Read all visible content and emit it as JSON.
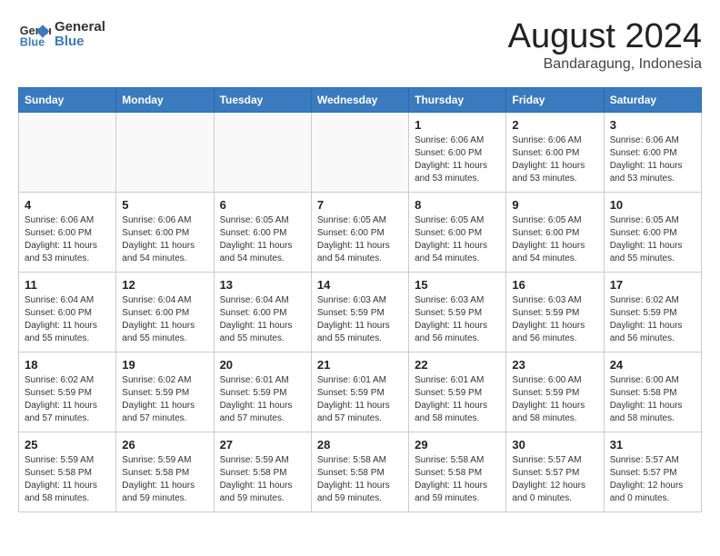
{
  "header": {
    "logo_line1": "General",
    "logo_line2": "Blue",
    "month": "August 2024",
    "location": "Bandaragung, Indonesia"
  },
  "weekdays": [
    "Sunday",
    "Monday",
    "Tuesday",
    "Wednesday",
    "Thursday",
    "Friday",
    "Saturday"
  ],
  "weeks": [
    [
      {
        "day": "",
        "info": ""
      },
      {
        "day": "",
        "info": ""
      },
      {
        "day": "",
        "info": ""
      },
      {
        "day": "",
        "info": ""
      },
      {
        "day": "1",
        "info": "Sunrise: 6:06 AM\nSunset: 6:00 PM\nDaylight: 11 hours\nand 53 minutes."
      },
      {
        "day": "2",
        "info": "Sunrise: 6:06 AM\nSunset: 6:00 PM\nDaylight: 11 hours\nand 53 minutes."
      },
      {
        "day": "3",
        "info": "Sunrise: 6:06 AM\nSunset: 6:00 PM\nDaylight: 11 hours\nand 53 minutes."
      }
    ],
    [
      {
        "day": "4",
        "info": "Sunrise: 6:06 AM\nSunset: 6:00 PM\nDaylight: 11 hours\nand 53 minutes."
      },
      {
        "day": "5",
        "info": "Sunrise: 6:06 AM\nSunset: 6:00 PM\nDaylight: 11 hours\nand 54 minutes."
      },
      {
        "day": "6",
        "info": "Sunrise: 6:05 AM\nSunset: 6:00 PM\nDaylight: 11 hours\nand 54 minutes."
      },
      {
        "day": "7",
        "info": "Sunrise: 6:05 AM\nSunset: 6:00 PM\nDaylight: 11 hours\nand 54 minutes."
      },
      {
        "day": "8",
        "info": "Sunrise: 6:05 AM\nSunset: 6:00 PM\nDaylight: 11 hours\nand 54 minutes."
      },
      {
        "day": "9",
        "info": "Sunrise: 6:05 AM\nSunset: 6:00 PM\nDaylight: 11 hours\nand 54 minutes."
      },
      {
        "day": "10",
        "info": "Sunrise: 6:05 AM\nSunset: 6:00 PM\nDaylight: 11 hours\nand 55 minutes."
      }
    ],
    [
      {
        "day": "11",
        "info": "Sunrise: 6:04 AM\nSunset: 6:00 PM\nDaylight: 11 hours\nand 55 minutes."
      },
      {
        "day": "12",
        "info": "Sunrise: 6:04 AM\nSunset: 6:00 PM\nDaylight: 11 hours\nand 55 minutes."
      },
      {
        "day": "13",
        "info": "Sunrise: 6:04 AM\nSunset: 6:00 PM\nDaylight: 11 hours\nand 55 minutes."
      },
      {
        "day": "14",
        "info": "Sunrise: 6:03 AM\nSunset: 5:59 PM\nDaylight: 11 hours\nand 55 minutes."
      },
      {
        "day": "15",
        "info": "Sunrise: 6:03 AM\nSunset: 5:59 PM\nDaylight: 11 hours\nand 56 minutes."
      },
      {
        "day": "16",
        "info": "Sunrise: 6:03 AM\nSunset: 5:59 PM\nDaylight: 11 hours\nand 56 minutes."
      },
      {
        "day": "17",
        "info": "Sunrise: 6:02 AM\nSunset: 5:59 PM\nDaylight: 11 hours\nand 56 minutes."
      }
    ],
    [
      {
        "day": "18",
        "info": "Sunrise: 6:02 AM\nSunset: 5:59 PM\nDaylight: 11 hours\nand 57 minutes."
      },
      {
        "day": "19",
        "info": "Sunrise: 6:02 AM\nSunset: 5:59 PM\nDaylight: 11 hours\nand 57 minutes."
      },
      {
        "day": "20",
        "info": "Sunrise: 6:01 AM\nSunset: 5:59 PM\nDaylight: 11 hours\nand 57 minutes."
      },
      {
        "day": "21",
        "info": "Sunrise: 6:01 AM\nSunset: 5:59 PM\nDaylight: 11 hours\nand 57 minutes."
      },
      {
        "day": "22",
        "info": "Sunrise: 6:01 AM\nSunset: 5:59 PM\nDaylight: 11 hours\nand 58 minutes."
      },
      {
        "day": "23",
        "info": "Sunrise: 6:00 AM\nSunset: 5:59 PM\nDaylight: 11 hours\nand 58 minutes."
      },
      {
        "day": "24",
        "info": "Sunrise: 6:00 AM\nSunset: 5:58 PM\nDaylight: 11 hours\nand 58 minutes."
      }
    ],
    [
      {
        "day": "25",
        "info": "Sunrise: 5:59 AM\nSunset: 5:58 PM\nDaylight: 11 hours\nand 58 minutes."
      },
      {
        "day": "26",
        "info": "Sunrise: 5:59 AM\nSunset: 5:58 PM\nDaylight: 11 hours\nand 59 minutes."
      },
      {
        "day": "27",
        "info": "Sunrise: 5:59 AM\nSunset: 5:58 PM\nDaylight: 11 hours\nand 59 minutes."
      },
      {
        "day": "28",
        "info": "Sunrise: 5:58 AM\nSunset: 5:58 PM\nDaylight: 11 hours\nand 59 minutes."
      },
      {
        "day": "29",
        "info": "Sunrise: 5:58 AM\nSunset: 5:58 PM\nDaylight: 11 hours\nand 59 minutes."
      },
      {
        "day": "30",
        "info": "Sunrise: 5:57 AM\nSunset: 5:57 PM\nDaylight: 12 hours\nand 0 minutes."
      },
      {
        "day": "31",
        "info": "Sunrise: 5:57 AM\nSunset: 5:57 PM\nDaylight: 12 hours\nand 0 minutes."
      }
    ]
  ]
}
